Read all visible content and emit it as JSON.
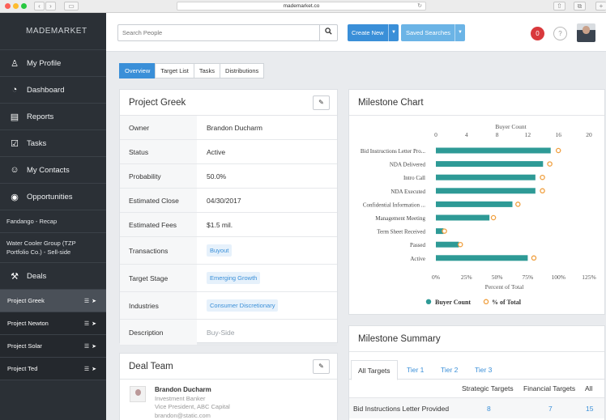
{
  "browser": {
    "url": "mademarket.co"
  },
  "sidebar": {
    "brand": "MADEMARKET",
    "nav": [
      {
        "label": "My Profile",
        "icon": "user-icon"
      },
      {
        "label": "Dashboard",
        "icon": "gauge-icon"
      },
      {
        "label": "Reports",
        "icon": "bar-chart-icon"
      },
      {
        "label": "Tasks",
        "icon": "checkbox-icon"
      },
      {
        "label": "My Contacts",
        "icon": "contact-icon"
      },
      {
        "label": "Opportunities",
        "icon": "target-icon"
      }
    ],
    "opportunities": [
      "Fandango - Recap",
      "Water Cooler Group (TZP Portfolio Co.) - Sell-side"
    ],
    "deals_label": "Deals",
    "deals": [
      "Project Greek",
      "Project Newton",
      "Project Solar",
      "Project Ted"
    ]
  },
  "topbar": {
    "search_placeholder": "Search People",
    "create_label": "Create New",
    "saved_label": "Saved Searches",
    "notification_count": "0",
    "help": "?"
  },
  "tabs": [
    "Overview",
    "Target List",
    "Tasks",
    "Distributions"
  ],
  "project": {
    "title": "Project Greek",
    "rows": [
      {
        "label": "Owner",
        "value": "Brandon Ducharm"
      },
      {
        "label": "Status",
        "value": "Active"
      },
      {
        "label": "Probability",
        "value": "50.0%"
      },
      {
        "label": "Estimated Close",
        "value": "04/30/2017"
      },
      {
        "label": "Estimated Fees",
        "value": "$1.5 mil."
      },
      {
        "label": "Transactions",
        "value": "Buyout"
      },
      {
        "label": "Target Stage",
        "value": "Emerging Growth"
      },
      {
        "label": "Industries",
        "value": "Consumer Discretionary"
      },
      {
        "label": "Description",
        "value": "Buy-Side"
      }
    ]
  },
  "deal_team": {
    "title": "Deal Team",
    "member": {
      "name": "Brandon Ducharm",
      "role": "Investment Banker",
      "position": "Vice President, ABC Capital",
      "email": "brandon@static.com"
    }
  },
  "milestone_chart": {
    "panel_title": "Milestone Chart"
  },
  "chart_data": {
    "type": "bar",
    "orientation": "horizontal",
    "categories": [
      "Bid Instructions Letter Pro...",
      "NDA Delivered",
      "Intro Call",
      "NDA Executed",
      "Confidential Information ...",
      "Management Meeting",
      "Term Sheet Received",
      "Passed",
      "Active"
    ],
    "series": [
      {
        "name": "Buyer Count",
        "values": [
          15,
          14,
          13,
          13,
          10,
          7,
          1,
          3,
          12
        ],
        "color": "#2e9a96",
        "axis": "top"
      },
      {
        "name": "% of Total",
        "values": [
          100,
          93,
          87,
          87,
          67,
          47,
          7,
          20,
          80
        ],
        "color": "#f0a040",
        "axis": "bottom"
      }
    ],
    "top_axis": {
      "label": "Buyer Count",
      "ticks": [
        "0",
        "4",
        "8",
        "12",
        "16",
        "20"
      ],
      "range": [
        0,
        20
      ]
    },
    "bottom_axis": {
      "label": "Percent of Total",
      "ticks": [
        "0%",
        "25%",
        "50%",
        "75%",
        "100%",
        "125%"
      ],
      "range": [
        0,
        125
      ]
    },
    "legend_position": "bottom"
  },
  "milestone_summary": {
    "title": "Milestone Summary",
    "tabs": [
      "All Targets",
      "Tier 1",
      "Tier 2",
      "Tier 3"
    ],
    "columns": [
      "Strategic Targets",
      "Financial Targets",
      "All"
    ],
    "rows": [
      {
        "label": "Bid Instructions Letter Provided",
        "strategic": "8",
        "financial": "7",
        "all": "15"
      }
    ]
  },
  "colors": {
    "primary": "#3a8fd8",
    "sidebar": "#2b3036",
    "teal": "#2e9a96",
    "orange": "#f0a040",
    "badge": "#d9393c"
  }
}
